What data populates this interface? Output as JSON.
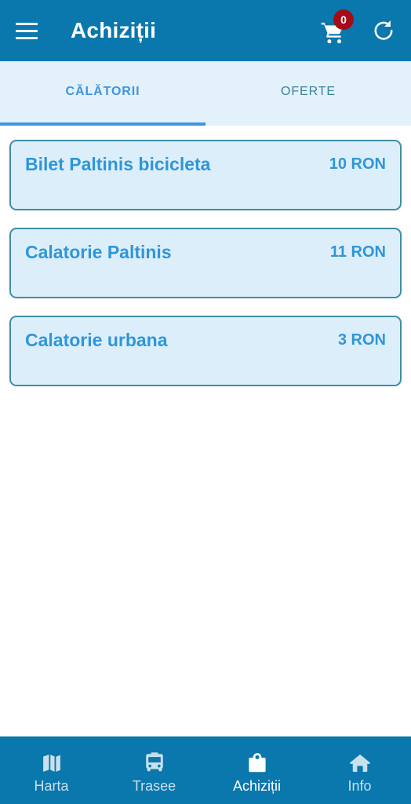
{
  "appbar": {
    "title": "Achiziții",
    "menu_icon": "hamburger-menu-icon",
    "cart_icon": "shopping-cart-icon",
    "cart_badge_count": "0",
    "refresh_icon": "refresh-icon",
    "background_color": "#0a77ad"
  },
  "tabs": {
    "background_color": "#e3f1fb",
    "indicator_color": "#3d96dc",
    "items": [
      {
        "label": "CĂLĂTORII",
        "active": true
      },
      {
        "label": "OFERTE",
        "active": false
      }
    ]
  },
  "tickets": {
    "accent_color": "#2e96d9",
    "card_background": "#ddeefb",
    "card_border": "#3f8da6",
    "items": [
      {
        "title": "Bilet Paltinis bicicleta",
        "price": "10 RON"
      },
      {
        "title": "Calatorie Paltinis",
        "price": "11 RON"
      },
      {
        "title": "Calatorie urbana",
        "price": "3 RON"
      }
    ]
  },
  "bottom_nav": {
    "background_color": "#0a77ad",
    "items": [
      {
        "label": "Harta",
        "icon": "map-icon",
        "active": false
      },
      {
        "label": "Trasee",
        "icon": "bus-icon",
        "active": false
      },
      {
        "label": "Achiziții",
        "icon": "shopping-bag-icon",
        "active": true
      },
      {
        "label": "Info",
        "icon": "home-icon",
        "active": false
      }
    ]
  }
}
